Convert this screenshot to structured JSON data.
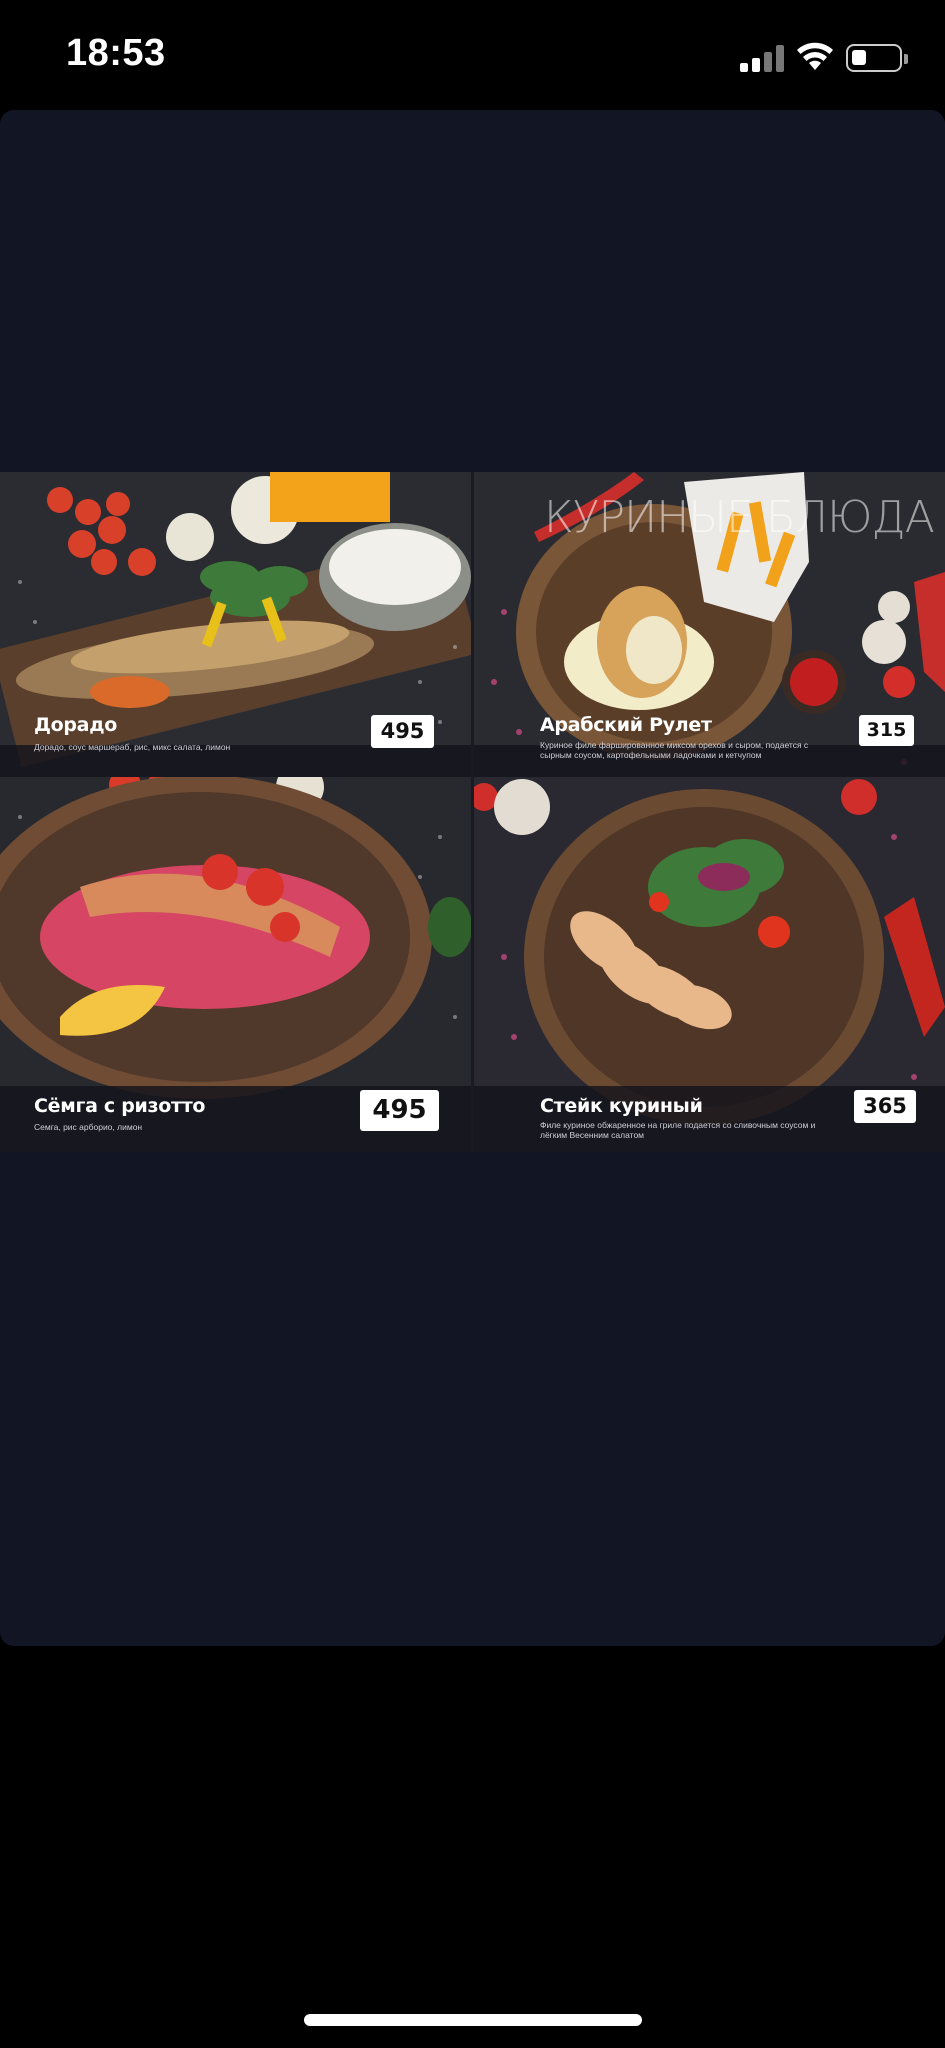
{
  "status_bar": {
    "time": "18:53"
  },
  "menu": {
    "section_title": "КУРИНЫЕ БЛЮДА",
    "items": [
      {
        "name": "Дорадо",
        "description": "Дорадо, соус маршераб, рис, микс салата, лимон",
        "price": "495"
      },
      {
        "name": "Арабский Рулет",
        "description": "Куриное филе фаршированное миксом орехов и сыром, подается с сырным соусом, картофельными ладочками и кетчупом",
        "price": "315"
      },
      {
        "name": "Сёмга с ризотто",
        "description": "Семга, рис арборио, лимон",
        "price": "495"
      },
      {
        "name": "Стейк куриный",
        "description": "Филе куриное обжаренное на гриле подается со сливочным соусом и лёгким Весенним салатом",
        "price": "365"
      }
    ]
  },
  "colors": {
    "viewer_bg": "#121624",
    "page_bg": "#000000",
    "price_bg": "#ffffff"
  }
}
